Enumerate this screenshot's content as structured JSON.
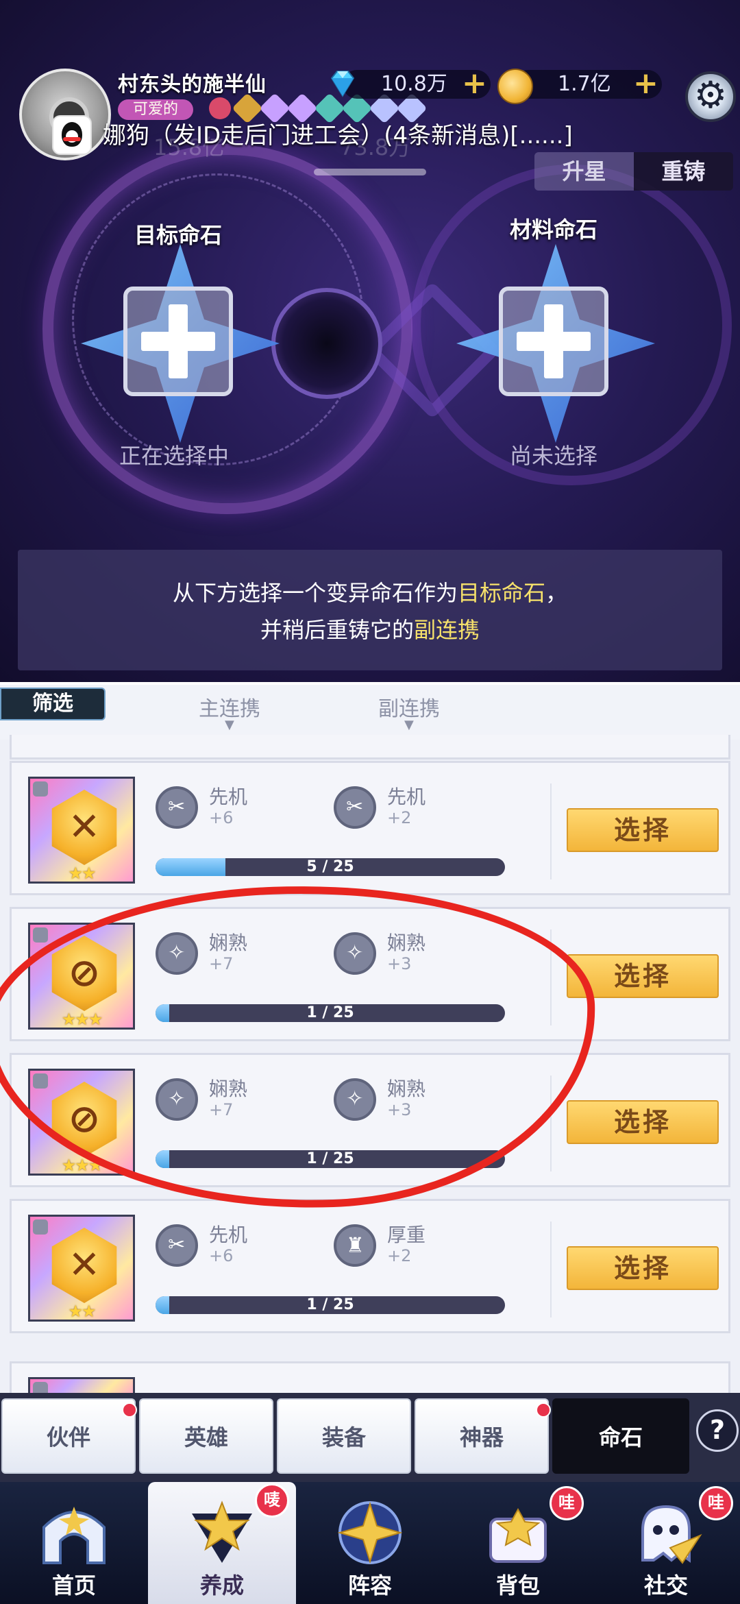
{
  "header": {
    "username": "村东头的施半仙",
    "title_tag": "可爱的",
    "diamonds": "10.8万",
    "gold": "1.7亿",
    "ticker": "娜狗（发ID走后门进工会）(4条新消息)[......]",
    "ghost_left": "15.8亿",
    "ghost_right": "73.8万"
  },
  "mode_tabs": {
    "upgrade": "升星",
    "reforge": "重铸"
  },
  "slots": {
    "target": {
      "label": "目标命石",
      "status": "正在选择中"
    },
    "material": {
      "label": "材料命石",
      "status": "尚未选择"
    }
  },
  "hint": {
    "line1_prefix": "从下方选择一个变异命石作为",
    "line1_highlight": "目标命石",
    "line1_suffix": "，",
    "line2_prefix": "并稍后重铸它的",
    "line2_highlight": "副连携"
  },
  "filter": {
    "button": "筛选",
    "col_main": "主连携",
    "col_sub": "副连携"
  },
  "stones": [
    {
      "stat1": "先机",
      "val1": "+6",
      "stat2": "先机",
      "val2": "+2",
      "progress_text": "5 / 25",
      "progress": 0.2,
      "stars": "★★",
      "select": "选择"
    },
    {
      "stat1": "娴熟",
      "val1": "+7",
      "stat2": "娴熟",
      "val2": "+3",
      "progress_text": "1 / 25",
      "progress": 0.04,
      "stars": "★★★",
      "select": "选择"
    },
    {
      "stat1": "娴熟",
      "val1": "+7",
      "stat2": "娴熟",
      "val2": "+3",
      "progress_text": "1 / 25",
      "progress": 0.04,
      "stars": "★★★",
      "select": "选择"
    },
    {
      "stat1": "先机",
      "val1": "+6",
      "stat2": "厚重",
      "val2": "+2",
      "progress_text": "1 / 25",
      "progress": 0.04,
      "stars": "★★",
      "select": "选择"
    }
  ],
  "sub_tabs": [
    "伙伴",
    "英雄",
    "装备",
    "神器",
    "命石"
  ],
  "help": "?",
  "nav": {
    "items": [
      "首页",
      "养成",
      "阵容",
      "背包",
      "社交"
    ],
    "badge": "哇",
    "badge_alt": "唛"
  }
}
